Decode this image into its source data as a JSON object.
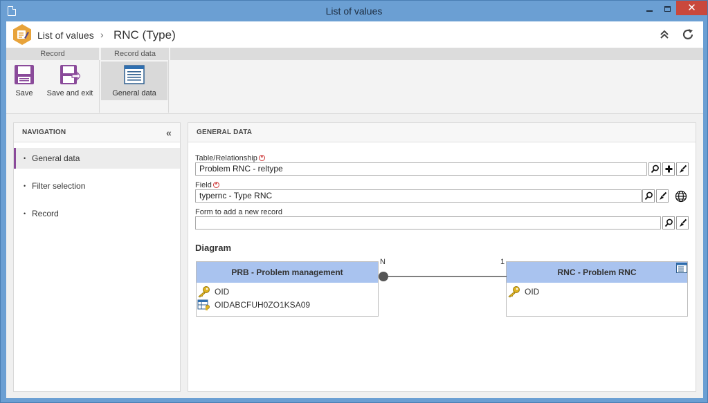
{
  "window": {
    "title": "List of values"
  },
  "header": {
    "crumb_root": "List of values",
    "crumb_sep": "›",
    "crumb_current": "RNC (Type)"
  },
  "ribbon": {
    "groups": {
      "record": "Record",
      "record_data": "Record data"
    },
    "buttons": {
      "save": "Save",
      "save_exit": "Save and exit",
      "general_data": "General data"
    }
  },
  "navigation": {
    "title": "NAVIGATION",
    "collapse_glyph": "«",
    "items": [
      {
        "label": "General data"
      },
      {
        "label": "Filter selection"
      },
      {
        "label": "Record"
      }
    ]
  },
  "general": {
    "title": "GENERAL DATA",
    "table_label": "Table/Relationship",
    "table_value": "Problem RNC - reltype",
    "field_label": "Field",
    "field_value": "typernc - Type RNC",
    "form_label": "Form to add a new record",
    "form_value": ""
  },
  "diagram": {
    "title": "Diagram",
    "left_entity": {
      "name": "PRB - Problem management",
      "fields": [
        "OID",
        "OIDABCFUH0ZO1KSA09"
      ]
    },
    "right_entity": {
      "name": "RNC - Problem RNC",
      "fields": [
        "OID"
      ]
    },
    "card_left": "N",
    "card_right": "1"
  },
  "colors": {
    "accent": "#8a4a9a",
    "entity_header": "#a9c3ef",
    "title_bar": "#6b9fd3",
    "close": "#c9483c"
  }
}
